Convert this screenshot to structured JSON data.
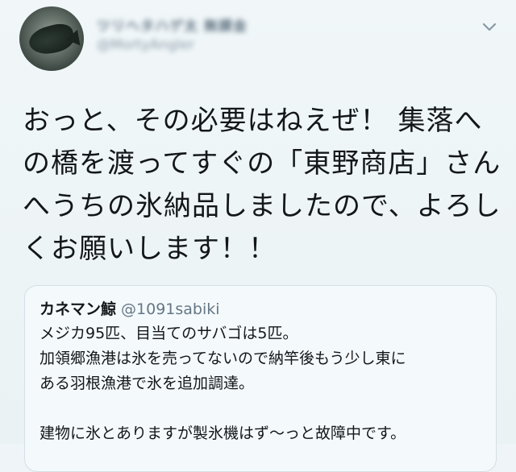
{
  "tweet": {
    "author_name": "ツリヘタハゲ太 無課金",
    "author_handle": "@MortyAngler",
    "body_lines": [
      "おっと、その必要はねえぜ！ 集落へ",
      "の橋を渡ってすぐの「東野商店」さん",
      "へうちの氷納品しましたので、よろし",
      "くお願いします！！"
    ],
    "icons": {
      "menu": "chevron-down-icon"
    }
  },
  "quoted_tweet": {
    "author_name": "カネマン鯨",
    "author_handle": "@1091sabiki",
    "body_lines": [
      "メジカ95匹、目当てのサバゴは5匹。",
      "加領郷漁港は氷を売ってないので納竿後もう少し東に",
      "ある羽根漁港で氷を追加調達。",
      "",
      "建物に氷とありますが製氷機はず〜っと故障中です。"
    ]
  },
  "colors": {
    "background": "#eef4f7",
    "text": "#14171a",
    "secondary_text": "#657786",
    "border": "#d5dfe5"
  }
}
